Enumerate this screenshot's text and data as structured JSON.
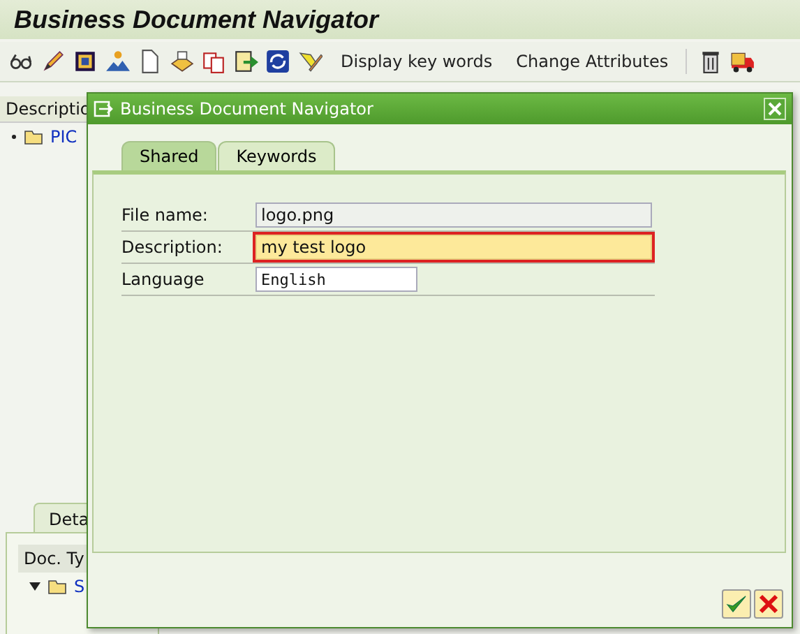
{
  "app_title": "Business Document Navigator",
  "toolbar": {
    "buttons": [
      "Display key words",
      "Change Attributes"
    ]
  },
  "left_pane": {
    "header": "Descriptio",
    "tree": [
      {
        "label": "PIC"
      }
    ]
  },
  "bottom_pane": {
    "tab": "Deta",
    "header": "Doc. Ty",
    "tree": [
      {
        "label": "S",
        "expanded": true
      }
    ]
  },
  "dialog": {
    "title": "Business Document Navigator",
    "tabs": [
      {
        "label": "Shared",
        "selected": true
      },
      {
        "label": "Keywords",
        "selected": false
      }
    ],
    "fields": [
      {
        "label": "File name:",
        "value": "logo.png",
        "kind": "display",
        "focused": false
      },
      {
        "label": "Description:",
        "value": "my test logo",
        "kind": "input",
        "focused": true
      },
      {
        "label": "Language",
        "value": "English",
        "kind": "short",
        "focused": false
      }
    ]
  }
}
